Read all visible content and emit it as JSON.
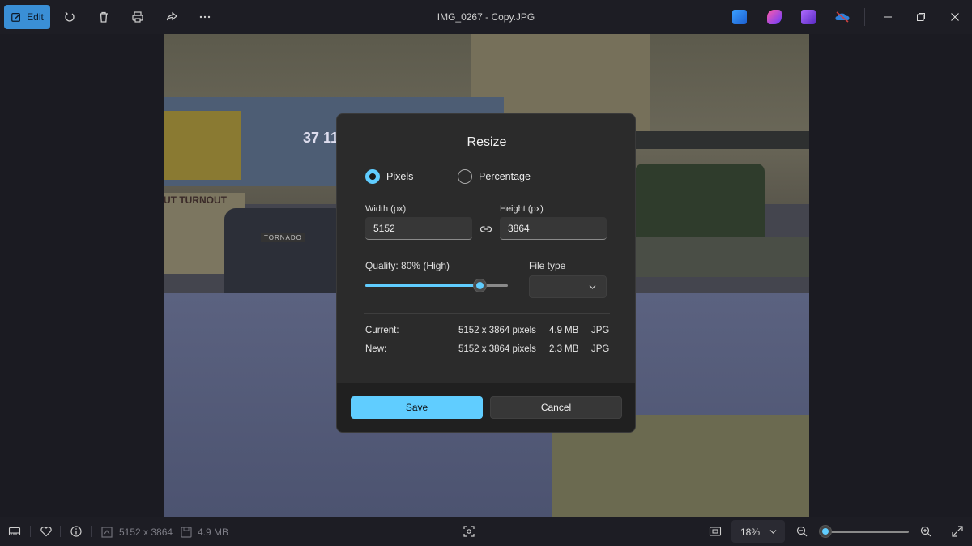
{
  "toolbar": {
    "edit_label": "Edit",
    "title": "IMG_0267 - Copy.JPG",
    "icons": [
      "edit-icon",
      "rotate-icon",
      "delete-icon",
      "print-icon",
      "share-icon",
      "more-icon"
    ],
    "apps": [
      "designer-icon",
      "clipchamp-icon",
      "video-editor-icon",
      "onedrive-icon"
    ]
  },
  "photo": {
    "engine_number": "37 111",
    "sign_text": "UT  TURNOUT",
    "loco_name": "TORNADO"
  },
  "dialog": {
    "title": "Resize",
    "mode_options": [
      {
        "label": "Pixels",
        "selected": true
      },
      {
        "label": "Percentage",
        "selected": false
      }
    ],
    "width_label": "Width  (px)",
    "width_value": "5152",
    "height_label": "Height  (px)",
    "height_value": "3864",
    "quality_label": "Quality: 80% (High)",
    "quality_value": 0.8,
    "file_type_label": "File type",
    "file_type_value": "",
    "current_label": "Current:",
    "current_dims": "5152 x 3864 pixels",
    "current_size": "4.9 MB",
    "current_type": "JPG",
    "new_label": "New:",
    "new_dims": "5152 x 3864 pixels",
    "new_size": "2.3 MB",
    "new_type": "JPG",
    "save_label": "Save",
    "cancel_label": "Cancel"
  },
  "statusbar": {
    "dimensions": "5152 x 3864",
    "file_size": "4.9 MB",
    "zoom": "18%",
    "zoom_level": 0.02
  },
  "colors": {
    "accent": "#60cdff",
    "edit_button": "#3a8fd6",
    "dialog_bg": "#2b2b2b"
  }
}
